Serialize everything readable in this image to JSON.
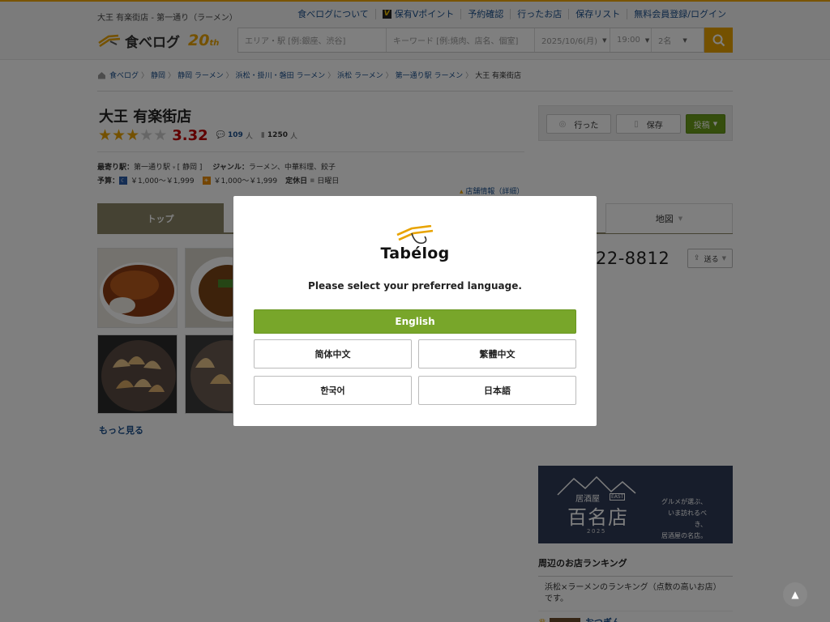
{
  "header": {
    "tagline": "大王 有楽街店 - 第一通り（ラーメン）",
    "links": [
      "食べログについて",
      "保有Vポイント",
      "予約確認",
      "行ったお店",
      "保存リスト",
      "無料会員登録/ログイン"
    ],
    "logo_text": "食べログ",
    "logo_anniv": "20",
    "logo_anniv_suffix": "th",
    "search": {
      "area_placeholder": "エリア・駅 [例:銀座、渋谷]",
      "keyword_placeholder": "キーワード [例:焼肉、店名、個室]",
      "date": "2025/10/6(月)",
      "time": "19:00",
      "people": "2名"
    }
  },
  "breadcrumb": [
    "食べログ",
    "静岡",
    "静岡 ラーメン",
    "浜松・掛川・磐田 ラーメン",
    "浜松 ラーメン",
    "第一通り駅 ラーメン",
    "大王 有楽街店"
  ],
  "store": {
    "name": "大王 有楽街店",
    "stars": 3,
    "score": "3.32",
    "reviews": "109",
    "bookmarks": "1250",
    "unit": "人",
    "station_label": "最寄り駅：",
    "station": "第一通り駅",
    "station_extra": "[ 静岡 ]",
    "genre_label": "ジャンル：",
    "genres": "ラーメン、中華料理、餃子",
    "budget_label": "予算：",
    "budget_dinner": "￥1,000～￥1,999",
    "budget_lunch": "￥1,000～￥1,999",
    "holiday_label": "定休日",
    "holiday": "日曜日",
    "store_info_link": "店舗情報（詳細）"
  },
  "actions": {
    "went": "行った",
    "save": "保存",
    "post": "投稿"
  },
  "tabs": {
    "top": "トップ",
    "map": "地図"
  },
  "more_photos": "もっと見る",
  "phone_partial": "22-8812",
  "send_label": "送る",
  "banner": {
    "small": "居酒屋",
    "east": "EAST",
    "big": "百名店",
    "year": "2025",
    "copy": [
      "グルメが選ぶ、",
      "いま訪れるべき、",
      "居酒屋の名店。"
    ]
  },
  "ranking": {
    "title": "周辺のお店ランキング",
    "desc": "浜松×ラーメンのランキング（点数の高いお店）です。",
    "first_item": "おつぎん"
  },
  "modal": {
    "logo_text": "Tabélog",
    "prompt": "Please select your preferred language.",
    "languages": [
      "English",
      "简体中文",
      "繁體中文",
      "한국어",
      "日本語"
    ]
  },
  "colors": {
    "accent": "#e8a300",
    "english_button": "#78a62a",
    "score": "#c10000",
    "link": "#1a4f8c",
    "tab_active": "#8a8467"
  }
}
